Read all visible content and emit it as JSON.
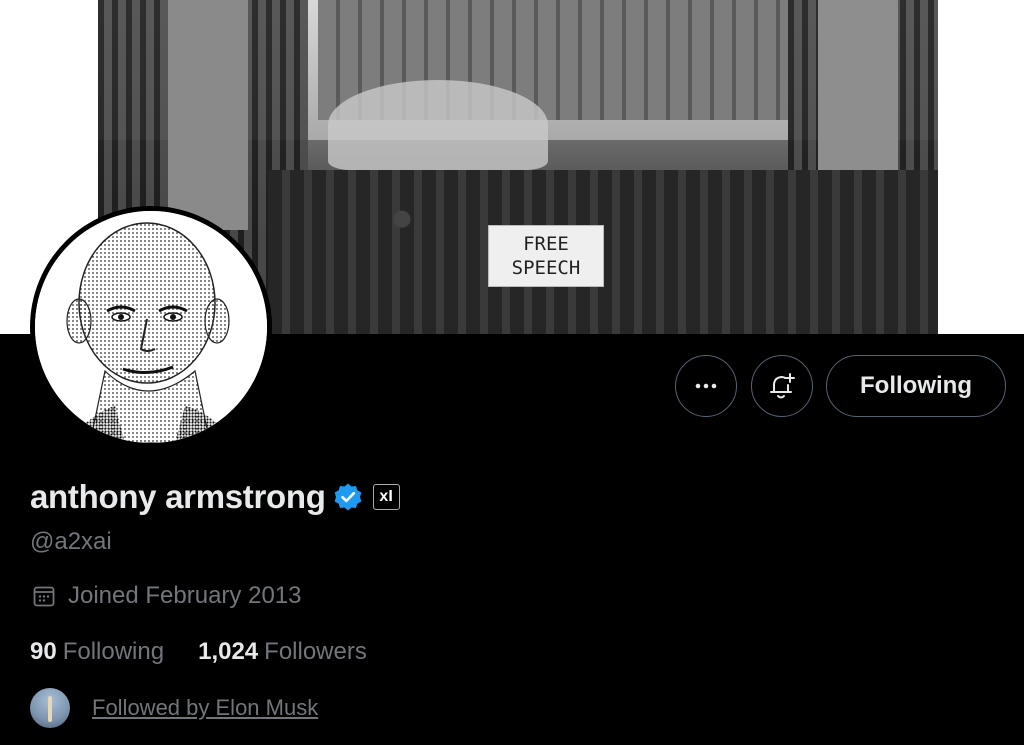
{
  "banner": {
    "sign_line1": "FREE",
    "sign_line2": "SPEECH"
  },
  "actions": {
    "more_icon": "more-horizontal-icon",
    "notify_icon": "bell-plus-icon",
    "following_label": "Following"
  },
  "profile": {
    "display_name": "anthony armstrong",
    "verified_badge": "verified-checkmark-icon",
    "affiliate_label": "xІ",
    "handle": "@a2xai",
    "joined": "Joined February 2013"
  },
  "stats": {
    "following_count": "90",
    "following_label": "Following",
    "followers_count": "1,024",
    "followers_label": "Followers"
  },
  "followed_by": {
    "text": "Followed by Elon Musk"
  },
  "colors": {
    "background": "#000000",
    "text_primary": "#e7e9ea",
    "text_secondary": "#71767b",
    "border": "#536471",
    "verified_blue": "#1d9bf0"
  }
}
